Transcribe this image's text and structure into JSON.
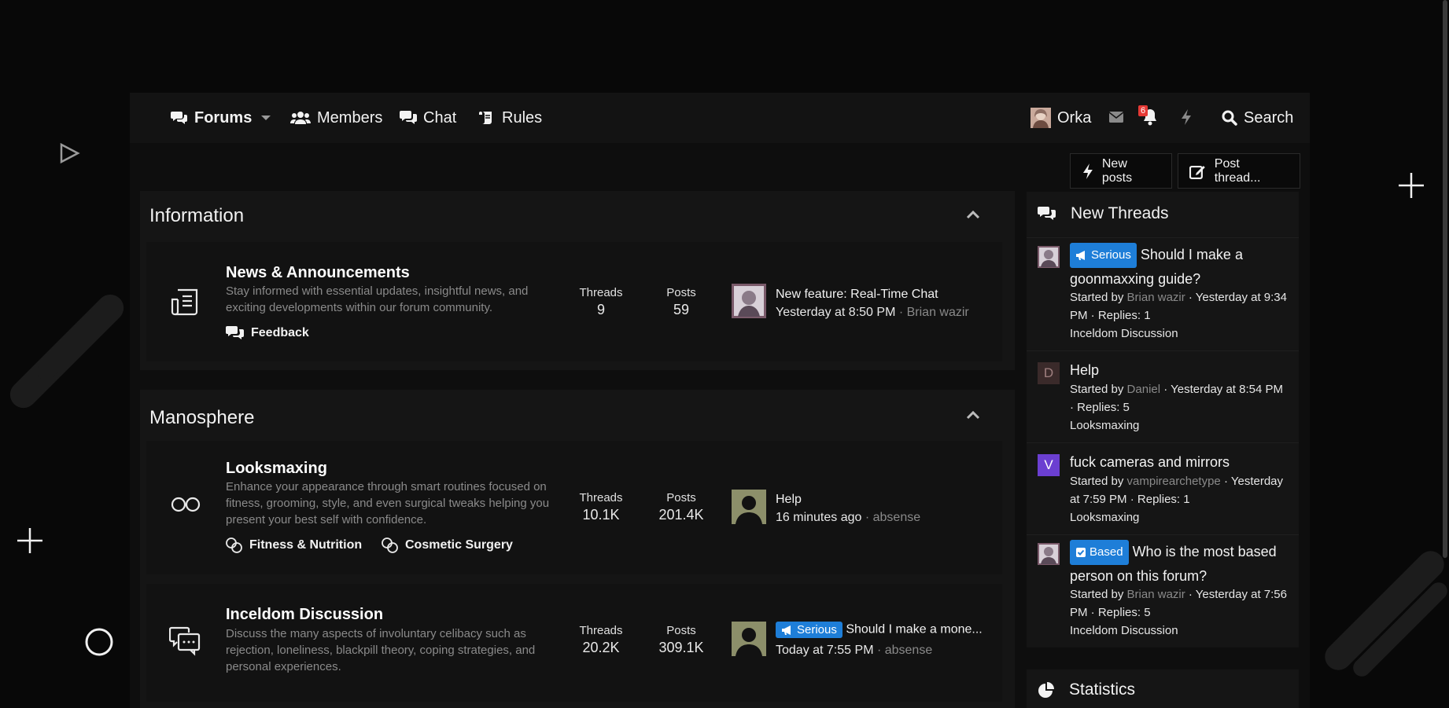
{
  "nav": {
    "forums": "Forums",
    "members": "Members",
    "chat": "Chat",
    "rules": "Rules",
    "user": "Orka",
    "alert_count": "6",
    "search": "Search"
  },
  "buttons": {
    "new_posts": "New posts",
    "post_thread": "Post thread..."
  },
  "categories": [
    {
      "title": "Information",
      "nodes": [
        {
          "title": "News & Announcements",
          "desc": "Stay informed with essential updates, insightful news, and exciting developments within our forum community.",
          "subforums": [
            "Feedback"
          ],
          "threads_label": "Threads",
          "threads": "9",
          "posts_label": "Posts",
          "posts": "59",
          "last_title": "New feature: Real-Time Chat",
          "last_time": "Yesterday at 8:50 PM",
          "last_user": "Brian wazir"
        }
      ]
    },
    {
      "title": "Manosphere",
      "nodes": [
        {
          "title": "Looksmaxing",
          "desc": "Enhance your appearance through smart routines focused on fitness, grooming, style, and even surgical tweaks helping you present your best self with confidence.",
          "subforums": [
            "Fitness & Nutrition",
            "Cosmetic Surgery"
          ],
          "threads_label": "Threads",
          "threads": "10.1K",
          "posts_label": "Posts",
          "posts": "201.4K",
          "last_title": "Help",
          "last_time": "16 minutes ago",
          "last_user": "absense"
        },
        {
          "title": "Inceldom Discussion",
          "desc": "Discuss the many aspects of involuntary celibacy such as rejection, loneliness, blackpill theory, coping strategies, and personal experiences.",
          "threads_label": "Threads",
          "threads": "20.2K",
          "posts_label": "Posts",
          "posts": "309.1K",
          "last_badge": "Serious",
          "last_title": "Should I make a mone...",
          "last_time": "Today at 7:55 PM",
          "last_user": "absense"
        }
      ]
    }
  ],
  "sidebar": {
    "new_threads_title": "New Threads",
    "statistics_title": "Statistics",
    "threads": [
      {
        "badge": "Serious",
        "title": "Should I make a goonmaxxing guide?",
        "started_by": "Started by",
        "user": "Brian wazir",
        "time": "Yesterday at 9:34 PM",
        "replies": "Replies: 1",
        "forum": "Inceldom Discussion"
      },
      {
        "avatar_letter": "D",
        "avatar_color": "#3a2a2a",
        "title": "Help",
        "started_by": "Started by",
        "user": "Daniel",
        "time": "Yesterday at 8:54 PM",
        "replies": "Replies: 5",
        "forum": "Looksmaxing"
      },
      {
        "avatar_letter": "V",
        "avatar_color": "#6b3fd1",
        "title": "fuck cameras and mirrors",
        "started_by": "Started by",
        "user": "vampirearchetype",
        "time": "Yesterday at 7:59 PM",
        "replies": "Replies: 1",
        "forum": "Looksmaxing"
      },
      {
        "badge": "Based",
        "title": "Who is the most based person on this forum?",
        "started_by": "Started by",
        "user": "Brian wazir",
        "time": "Yesterday at 7:56 PM",
        "replies": "Replies: 5",
        "forum": "Inceldom Discussion"
      }
    ]
  },
  "colors": {
    "badge_blue": "#1e7ed8",
    "alert_red": "#e53935"
  }
}
